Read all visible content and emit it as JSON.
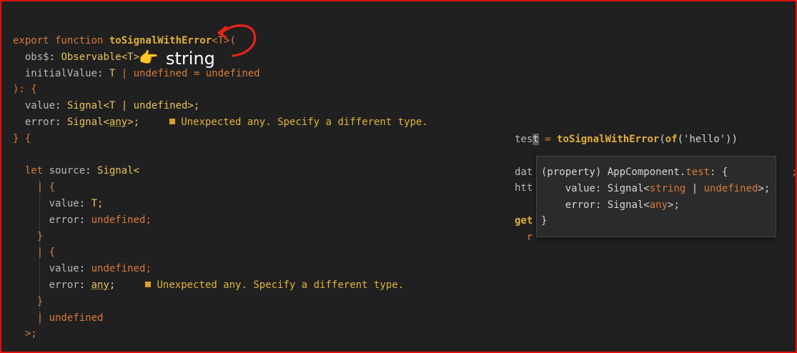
{
  "editor": {
    "line1": {
      "kw": "export function ",
      "name": "toSignalWithError",
      "generic": "<T>("
    },
    "line2": {
      "prop": "obs$",
      "sep": ": ",
      "type": "Observable<T>"
    },
    "annotation": {
      "pointer": "👉",
      "text": "string"
    },
    "line3": {
      "prop": "initialValue",
      "sep": ": ",
      "t": "T",
      "rest": " | undefined = undefined"
    },
    "line4": {
      "text": "): {"
    },
    "line5": {
      "prop": "value",
      "sep": ": ",
      "type": "Signal<T | undefined>;"
    },
    "line6": {
      "prop": "error",
      "sep": ": ",
      "type_a": "Signal<",
      "any": "any",
      "type_b": ">;",
      "warning": "Unexpected any. Specify a different type."
    },
    "line7": {
      "text": "} {"
    },
    "line9": {
      "kw": "let ",
      "name": "source",
      "sep": ": ",
      "type": "Signal<"
    },
    "line10": {
      "text": "| {"
    },
    "line11": {
      "prop": "value",
      "sep": ": ",
      "type": "T;"
    },
    "line12": {
      "prop": "error",
      "sep": ": ",
      "type": "undefined;"
    },
    "line13": {
      "text": "}"
    },
    "line14": {
      "text": "| {"
    },
    "line15": {
      "prop": "value",
      "sep": ": ",
      "type": "undefined;"
    },
    "line16": {
      "prop": "error",
      "sep": ": ",
      "any": "any",
      "semi": ";",
      "warning": "Unexpected any. Specify a different type."
    },
    "line17": {
      "text": "}"
    },
    "line18": {
      "text": "| undefined"
    },
    "line19": {
      "text": ">;"
    }
  },
  "right_code": {
    "r1": {
      "a": "tes",
      "cursor": "t",
      "b": " = ",
      "fn": "toSignalWithError",
      "c": "(",
      "of": "of",
      "d": "('hello'))"
    },
    "r2": {
      "a": "dat",
      "semi": ";"
    },
    "r3": {
      "a": "htt"
    },
    "r4": {
      "a": "get"
    },
    "r5": {
      "a": "r"
    }
  },
  "tooltip": {
    "l1": {
      "a": "(property) AppComponent.",
      "b": "test",
      "c": ": {"
    },
    "l2": {
      "a": "value",
      "b": ": Signal<",
      "c": "string",
      "d": " | ",
      "e": "undefined",
      "f": ">;"
    },
    "l3": {
      "a": "error",
      "b": ": Signal<",
      "c": "any",
      "d": ">;"
    },
    "l4": {
      "a": "}"
    }
  },
  "colors": {
    "frame": "#e01010",
    "background": "#202020",
    "annotation_arrow": "#e8241a"
  }
}
